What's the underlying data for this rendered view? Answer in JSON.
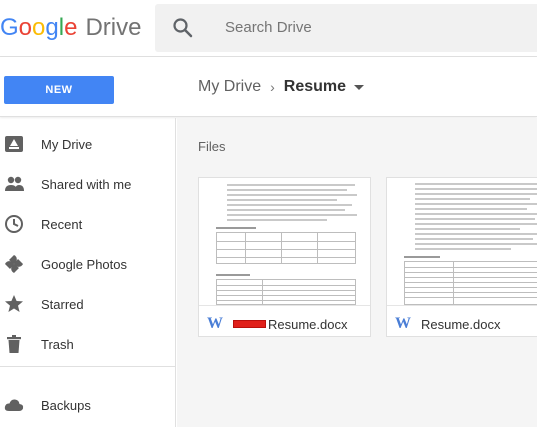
{
  "header": {
    "logo_letters": [
      "G",
      "o",
      "o",
      "g",
      "l",
      "e"
    ],
    "logo_product": "Drive",
    "search_placeholder": "Search Drive"
  },
  "toolbar": {
    "new_label": "NEW",
    "breadcrumb_root": "My Drive",
    "breadcrumb_separator": "›",
    "breadcrumb_current": "Resume"
  },
  "sidebar": {
    "items": [
      {
        "label": "My Drive",
        "icon": "drive-icon"
      },
      {
        "label": "Shared with me",
        "icon": "people-icon"
      },
      {
        "label": "Recent",
        "icon": "clock-icon"
      },
      {
        "label": "Google Photos",
        "icon": "photos-icon"
      },
      {
        "label": "Starred",
        "icon": "star-icon"
      },
      {
        "label": "Trash",
        "icon": "trash-icon"
      },
      {
        "label": "Backups",
        "icon": "cloud-icon"
      }
    ]
  },
  "main": {
    "section_title": "Files",
    "files": [
      {
        "name": "Resume.docx",
        "icon": "word-doc-icon",
        "redacted_prefix": true
      },
      {
        "name": "Resume.docx",
        "icon": "word-doc-icon",
        "redacted_prefix": false
      }
    ]
  },
  "colors": {
    "accent": "#4285F4",
    "redaction": "#e0201a",
    "word_blue": "#4a7ed6"
  }
}
